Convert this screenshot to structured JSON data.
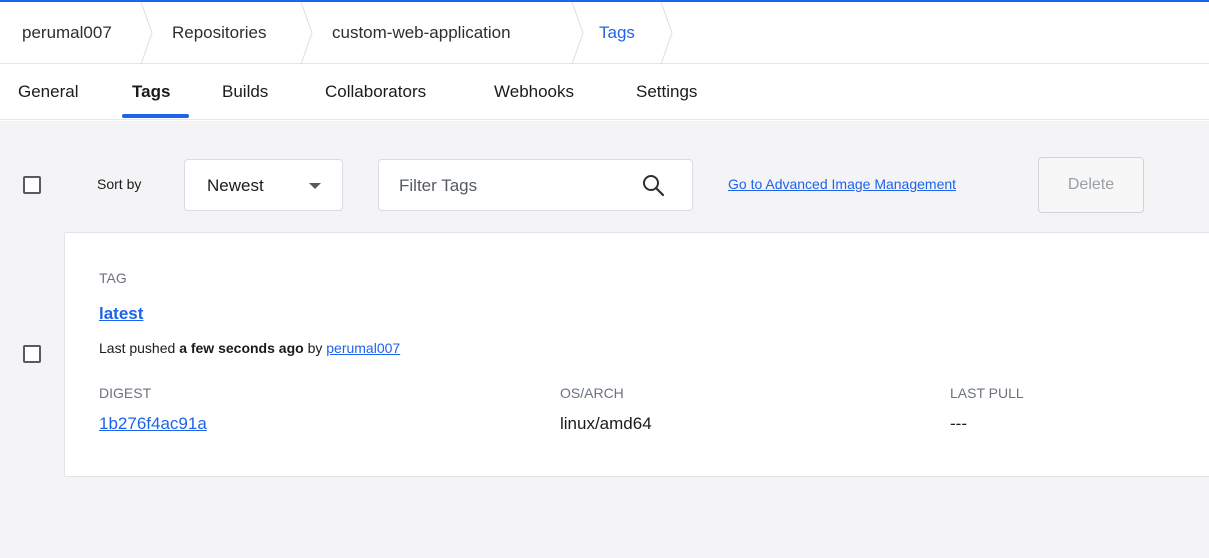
{
  "breadcrumb": {
    "items": [
      {
        "label": "perumal007"
      },
      {
        "label": "Repositories"
      },
      {
        "label": "custom-web-application"
      },
      {
        "label": "Tags"
      }
    ]
  },
  "tabs": [
    {
      "label": "General"
    },
    {
      "label": "Tags",
      "active": true
    },
    {
      "label": "Builds"
    },
    {
      "label": "Collaborators"
    },
    {
      "label": "Webhooks"
    },
    {
      "label": "Settings"
    }
  ],
  "toolbar": {
    "sort_label": "Sort by",
    "sort_value": "Newest",
    "filter_placeholder": "Filter Tags",
    "advanced_link": "Go to Advanced Image Management",
    "delete_label": "Delete"
  },
  "tag_card": {
    "tag_header": "TAG",
    "tag_name": "latest",
    "pushed_prefix": "Last pushed",
    "pushed_time": "a few seconds ago",
    "pushed_by": "by",
    "pushed_user": "perumal007",
    "digest_header": "DIGEST",
    "digest_value": "1b276f4ac91a",
    "osarch_header": "OS/ARCH",
    "osarch_value": "linux/amd64",
    "lastpull_header": "LAST PULL",
    "lastpull_value": "---"
  },
  "colors": {
    "accent": "#1d63ed",
    "background": "#f4f4f6"
  }
}
